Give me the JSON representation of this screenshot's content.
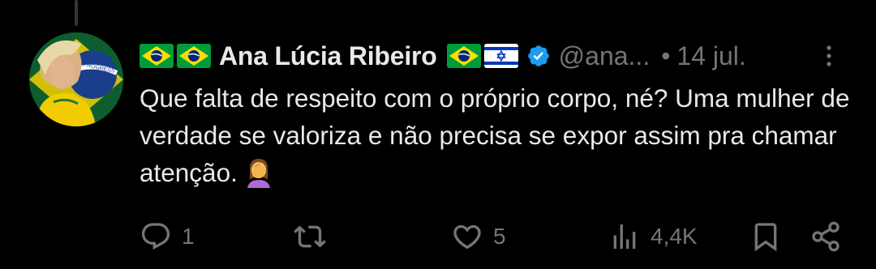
{
  "author": {
    "name": "Ana Lúcia Ribeiro",
    "handle": "@ana...",
    "date": "14 jul.",
    "separator": "•",
    "leading_flags": [
      "brazil-flag",
      "brazil-flag"
    ],
    "trailing_flags": [
      "brazil-flag",
      "israel-flag"
    ],
    "verified": true,
    "avatar_text": "PROGRESS"
  },
  "tweet": {
    "text": "Que falta de respeito com o próprio corpo, né? Uma mulher de verdade se valoriza e não precisa se expor assim pra chamar atenção.",
    "emoji": "woman-facepalming"
  },
  "actions": {
    "replies": "1",
    "reposts": "",
    "likes": "5",
    "views": "4,4K"
  },
  "colors": {
    "background": "#000000",
    "text_primary": "#e7e9ea",
    "text_secondary": "#71767b",
    "verified_blue": "#1d9bf0",
    "thread_line": "#333639"
  }
}
